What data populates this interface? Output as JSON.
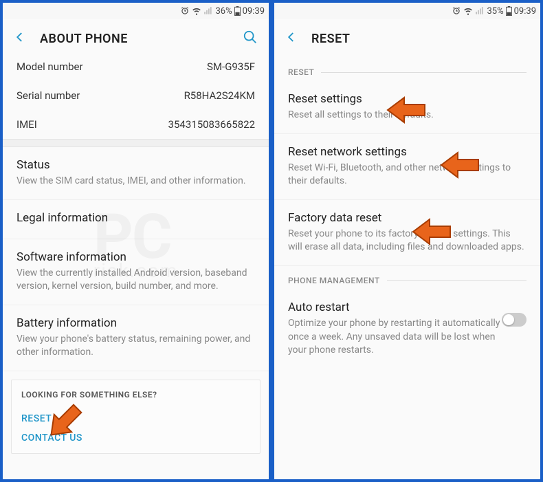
{
  "left": {
    "status": {
      "battery": "36%",
      "time": "09:39"
    },
    "header": {
      "title": "ABOUT PHONE"
    },
    "model": {
      "label": "Model number",
      "value": "SM-G935F"
    },
    "serial": {
      "label": "Serial number",
      "value": "R58HA2S24KM"
    },
    "imei": {
      "label": "IMEI",
      "value": "354315083665822"
    },
    "status_item": {
      "title": "Status",
      "desc": "View the SIM card status, IMEI, and other information."
    },
    "legal": {
      "title": "Legal information"
    },
    "software": {
      "title": "Software information",
      "desc": "View the currently installed Android version, baseband version, kernel version, build number, and more."
    },
    "battery": {
      "title": "Battery information",
      "desc": "View your phone's battery status, remaining power, and other information."
    },
    "footer": {
      "heading": "LOOKING FOR SOMETHING ELSE?",
      "reset": "RESET",
      "contact": "CONTACT US"
    }
  },
  "right": {
    "status": {
      "battery": "35%",
      "time": "09:39"
    },
    "header": {
      "title": "RESET"
    },
    "sections": {
      "reset": "RESET",
      "phone_mgmt": "PHONE MANAGEMENT"
    },
    "reset_settings": {
      "title": "Reset settings",
      "desc": "Reset all settings to their defaults."
    },
    "reset_network": {
      "title": "Reset network settings",
      "desc": "Reset Wi-Fi, Bluetooth, and other network settings to their defaults."
    },
    "factory": {
      "title": "Factory data reset",
      "desc": "Reset your phone to its factory default settings. This will erase all data, including files and downloaded apps."
    },
    "auto_restart": {
      "title": "Auto restart",
      "desc": "Optimize your phone by restarting it automatically once a week. Any unsaved data will be lost when your phone restarts."
    }
  },
  "watermark": {
    "main": "PC",
    "sub": "risk.com"
  }
}
